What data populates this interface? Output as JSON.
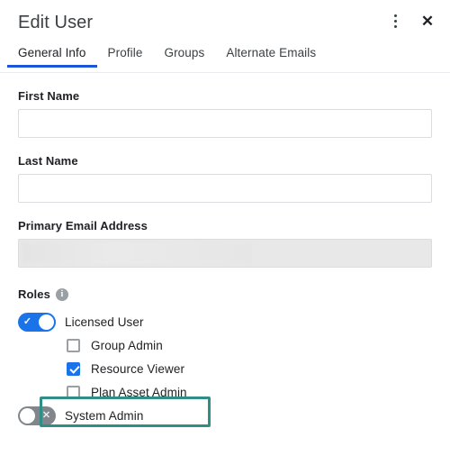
{
  "header": {
    "title": "Edit User",
    "menu_icon": "kebab-menu-icon",
    "close_icon": "close-icon"
  },
  "tabs": [
    {
      "label": "General Info",
      "active": true
    },
    {
      "label": "Profile",
      "active": false
    },
    {
      "label": "Groups",
      "active": false
    },
    {
      "label": "Alternate Emails",
      "active": false
    }
  ],
  "form": {
    "first_name": {
      "label": "First Name",
      "value": "",
      "placeholder": ""
    },
    "last_name": {
      "label": "Last Name",
      "value": "",
      "placeholder": ""
    },
    "primary_email": {
      "label": "Primary Email Address",
      "value": "",
      "placeholder": "",
      "disabled": true
    }
  },
  "roles": {
    "title": "Roles",
    "info_icon": "info-icon",
    "items": [
      {
        "label": "Licensed User",
        "control": "toggle",
        "state": "on"
      },
      {
        "label": "Group Admin",
        "control": "checkbox",
        "state": "unchecked"
      },
      {
        "label": "Resource Viewer",
        "control": "checkbox",
        "state": "checked"
      },
      {
        "label": "Plan Asset Admin",
        "control": "checkbox",
        "state": "unchecked",
        "highlighted": true
      },
      {
        "label": "System Admin",
        "control": "toggle",
        "state": "off"
      }
    ]
  },
  "glyphs": {
    "close": "✕",
    "info": "i",
    "toggle_on_mark": "✓",
    "toggle_off_mark": "✕"
  },
  "colors": {
    "accent_blue": "#1a73e8",
    "tab_underline": "#1a57d6",
    "highlight_teal": "#2f8f86",
    "toggle_off_gray": "#80868b",
    "disabled_field": "#e8e8e8"
  }
}
